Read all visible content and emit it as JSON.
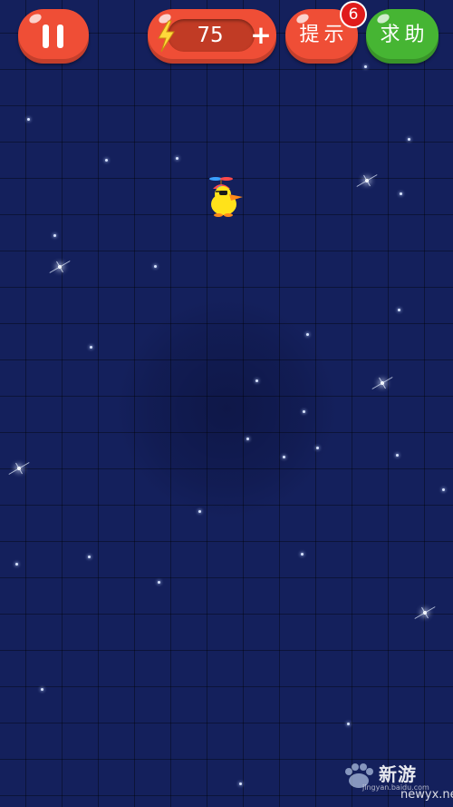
{
  "hud": {
    "energy_value": "75",
    "energy_plus": "+",
    "hint_label": "提示",
    "hint_badge": "6",
    "help_label": "求助"
  },
  "watermark": {
    "brand": "新游",
    "domain_small": "jingyan.baidu.com",
    "domain": "newyx.net"
  },
  "colors": {
    "background": "#14205c",
    "button_red": "#ef4e36",
    "button_green": "#46b533",
    "badge_red": "#e01b1b",
    "duck_yellow": "#ffe21a"
  },
  "icons": [
    "pause-icon",
    "lightning-icon",
    "plus-icon",
    "duck-character",
    "paw-icon"
  ]
}
